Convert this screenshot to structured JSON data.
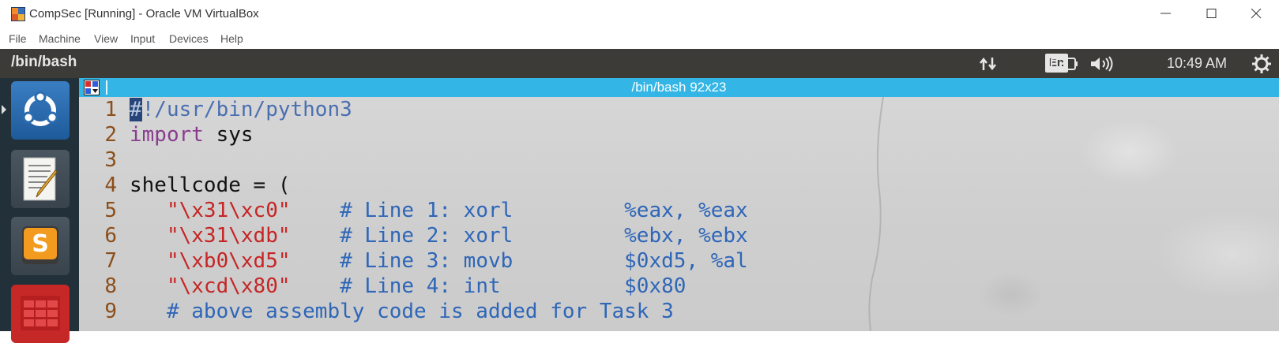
{
  "window": {
    "title": "CompSec [Running] - Oracle VM VirtualBox",
    "menu": [
      "File",
      "Machine",
      "View",
      "Input",
      "Devices",
      "Help"
    ]
  },
  "guest_panel": {
    "title": "/bin/bash",
    "keyboard": "En",
    "clock": "10:49 AM"
  },
  "launcher": {
    "items": [
      "ubuntu-dash-icon",
      "text-editor-icon",
      "sublime-text-icon",
      "app-grid-icon"
    ]
  },
  "terminal": {
    "tab_title": "/bin/bash 92x23",
    "lines": [
      {
        "num": "1",
        "segments": [
          {
            "t": "#",
            "c": "cur"
          },
          {
            "t": "!/usr/bin/python3",
            "c": "c-pre"
          }
        ]
      },
      {
        "num": "2",
        "segments": [
          {
            "t": "import",
            "c": "kw"
          },
          {
            "t": " sys",
            "c": "plain"
          }
        ]
      },
      {
        "num": "3",
        "segments": []
      },
      {
        "num": "4",
        "segments": [
          {
            "t": "shellcode = (",
            "c": "plain"
          }
        ]
      },
      {
        "num": "5",
        "segments": [
          {
            "t": "   ",
            "c": "plain"
          },
          {
            "t": "\"\\x31\\xc0\"",
            "c": "str"
          },
          {
            "t": "    # Line 1: xorl         %eax, %eax",
            "c": "cmt"
          }
        ]
      },
      {
        "num": "6",
        "segments": [
          {
            "t": "   ",
            "c": "plain"
          },
          {
            "t": "\"\\x31\\xdb\"",
            "c": "str"
          },
          {
            "t": "    # Line 2: xorl         %ebx, %ebx",
            "c": "cmt"
          }
        ]
      },
      {
        "num": "7",
        "segments": [
          {
            "t": "   ",
            "c": "plain"
          },
          {
            "t": "\"\\xb0\\xd5\"",
            "c": "str"
          },
          {
            "t": "    # Line 3: movb         $0xd5, %al",
            "c": "cmt"
          }
        ]
      },
      {
        "num": "8",
        "segments": [
          {
            "t": "   ",
            "c": "plain"
          },
          {
            "t": "\"\\xcd\\x80\"",
            "c": "str"
          },
          {
            "t": "    # Line 4: int          $0x80",
            "c": "cmt"
          }
        ]
      },
      {
        "num": "9",
        "segments": [
          {
            "t": "   # above assembly code is added for Task 3",
            "c": "cmt"
          }
        ]
      }
    ]
  },
  "colors": {
    "panel_bg": "#3c3b37",
    "tab_bar": "#33b5e5",
    "launcher_bg": "#22303a"
  }
}
